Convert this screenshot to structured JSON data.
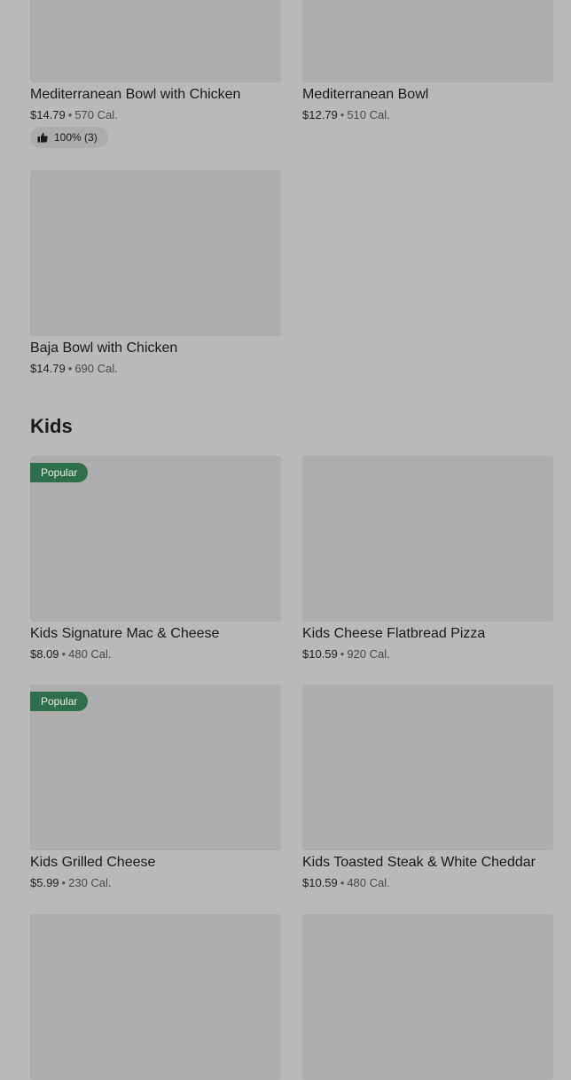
{
  "bowls": {
    "items": [
      {
        "name": "Mediterranean Bowl with Chicken",
        "price": "$14.79",
        "calories": "570 Cal.",
        "rating": "100% (3)"
      },
      {
        "name": "Mediterranean Bowl",
        "price": "$12.79",
        "calories": "510 Cal."
      },
      {
        "name": "Baja Bowl with Chicken",
        "price": "$14.79",
        "calories": "690 Cal."
      }
    ]
  },
  "kids": {
    "title": "Kids",
    "items": [
      {
        "name": "Kids Signature Mac & Cheese",
        "price": "$8.09",
        "calories": "480 Cal.",
        "badge": "Popular"
      },
      {
        "name": "Kids Cheese Flatbread Pizza",
        "price": "$10.59",
        "calories": "920 Cal."
      },
      {
        "name": "Kids Grilled Cheese",
        "price": "$5.99",
        "calories": "230 Cal.",
        "badge": "Popular"
      },
      {
        "name": "Kids Toasted Steak & White Cheddar",
        "price": "$10.59",
        "calories": "480 Cal."
      }
    ]
  },
  "separator": "•",
  "icons": {
    "rating": "thumbs-up-icon"
  },
  "colors": {
    "popular_badge": "#2e6e4a",
    "overlay": "#b9b9b9"
  }
}
